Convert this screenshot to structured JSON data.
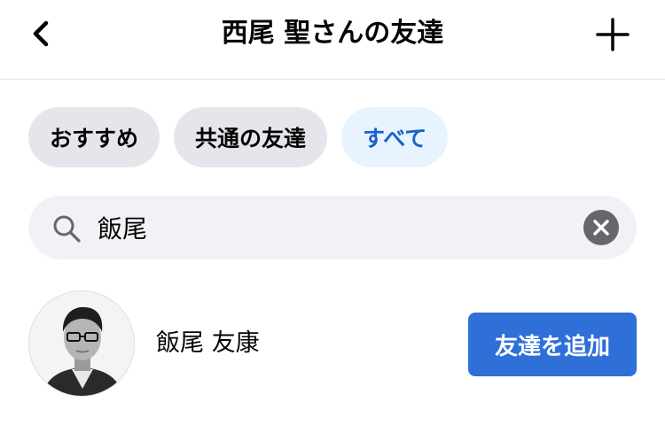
{
  "header": {
    "title": "西尾 聖さんの友達",
    "back_icon": "chevron-left-icon",
    "add_icon": "plus-icon"
  },
  "filters": [
    {
      "label": "おすすめ",
      "active": false
    },
    {
      "label": "共通の友達",
      "active": false
    },
    {
      "label": "すべて",
      "active": true
    }
  ],
  "search": {
    "value": "飯尾",
    "icon": "search-icon",
    "clear_icon": "clear-icon"
  },
  "results": [
    {
      "name": "飯尾 友康",
      "action_label": "友達を追加",
      "avatar": "avatar-photo"
    }
  ],
  "colors": {
    "accent": "#2e6fd8",
    "active_chip_bg": "#e7f3ff",
    "active_chip_text": "#1b62c8",
    "chip_bg": "#e4e6eb",
    "search_bg": "#f0f2f5"
  }
}
